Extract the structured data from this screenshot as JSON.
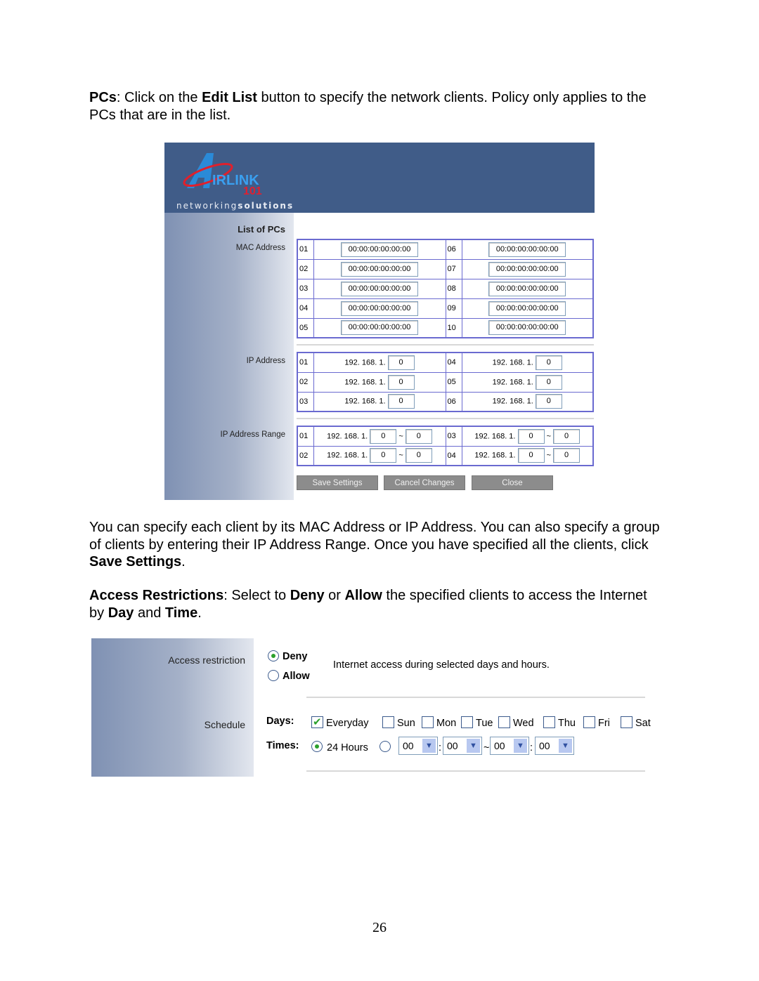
{
  "intro": {
    "term": "PCs",
    "t1": ": Click on the ",
    "b1": "Edit List",
    "t2": " button to specify the network clients. Policy only applies to the PCs that are in the list."
  },
  "shot1": {
    "logo_text": "AIRLINK 101",
    "tagline_a": "networking",
    "tagline_b": "solutions",
    "list_title": "List of PCs",
    "mac_label": "MAC Address",
    "ip_label": "IP Address",
    "range_label": "IP Address Range",
    "ip_prefix": "192. 168. 1.",
    "range_sep": "~",
    "mac_rows": [
      {
        "a": "01",
        "av": "00:00:00:00:00:00",
        "b": "06",
        "bv": "00:00:00:00:00:00"
      },
      {
        "a": "02",
        "av": "00:00:00:00:00:00",
        "b": "07",
        "bv": "00:00:00:00:00:00"
      },
      {
        "a": "03",
        "av": "00:00:00:00:00:00",
        "b": "08",
        "bv": "00:00:00:00:00:00"
      },
      {
        "a": "04",
        "av": "00:00:00:00:00:00",
        "b": "09",
        "bv": "00:00:00:00:00:00"
      },
      {
        "a": "05",
        "av": "00:00:00:00:00:00",
        "b": "10",
        "bv": "00:00:00:00:00:00"
      }
    ],
    "ip_rows": [
      {
        "a": "01",
        "av": "0",
        "b": "04",
        "bv": "0"
      },
      {
        "a": "02",
        "av": "0",
        "b": "05",
        "bv": "0"
      },
      {
        "a": "03",
        "av": "0",
        "b": "06",
        "bv": "0"
      }
    ],
    "range_rows": [
      {
        "a": "01",
        "a1": "0",
        "a2": "0",
        "b": "03",
        "b1": "0",
        "b2": "0"
      },
      {
        "a": "02",
        "a1": "0",
        "a2": "0",
        "b": "04",
        "b1": "0",
        "b2": "0"
      }
    ],
    "buttons": {
      "save": "Save Settings",
      "cancel": "Cancel Changes",
      "close": "Close"
    }
  },
  "para2": {
    "t1": "You can specify each client by its MAC Address or IP Address. You can also specify a group of clients by entering their IP Address Range. Once you have specified all the clients, click ",
    "b1": "Save Settings",
    "t2": "."
  },
  "para3": {
    "b1": "Access Restrictions",
    "t1": ": Select to ",
    "b2": "Deny",
    "t2": " or ",
    "b3": "Allow",
    "t3": " the specified clients to access the Internet by ",
    "b4": "Day",
    "t4": " and ",
    "b5": "Time",
    "t5": "."
  },
  "shot2": {
    "access_label": "Access restriction",
    "schedule_label": "Schedule",
    "deny": "Deny",
    "allow": "Allow",
    "selected": "Deny",
    "desc": "Internet access during selected days and hours.",
    "days_label": "Days:",
    "days": [
      {
        "label": "Everyday",
        "checked": true
      },
      {
        "label": "Sun",
        "checked": false
      },
      {
        "label": "Mon",
        "checked": false
      },
      {
        "label": "Tue",
        "checked": false
      },
      {
        "label": "Wed",
        "checked": false
      },
      {
        "label": "Thu",
        "checked": false
      },
      {
        "label": "Fri",
        "checked": false
      },
      {
        "label": "Sat",
        "checked": false
      }
    ],
    "times_label": "Times:",
    "hours24": "24 Hours",
    "time_mode": "24 Hours",
    "start_hour": "00",
    "start_min": "00",
    "end_hour": "00",
    "end_min": "00",
    "colon": ":",
    "tilde": "~"
  },
  "page_number": "26"
}
